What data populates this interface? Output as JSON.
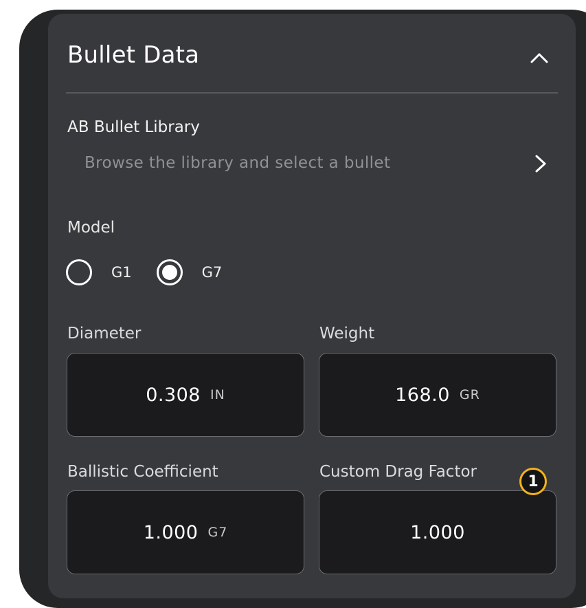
{
  "header": {
    "title": "Bullet Data",
    "collapse_icon": "chevron-up-icon"
  },
  "library": {
    "title": "AB Bullet Library",
    "subtitle": "Browse the library and select a bullet",
    "chevron_icon": "chevron-right-icon"
  },
  "model": {
    "label": "Model",
    "options": [
      {
        "label": "G1",
        "selected": false
      },
      {
        "label": "G7",
        "selected": true
      }
    ]
  },
  "fields": {
    "diameter": {
      "label": "Diameter",
      "value": "0.308",
      "unit": "IN"
    },
    "weight": {
      "label": "Weight",
      "value": "168.0",
      "unit": "GR"
    },
    "ballistic_coefficient": {
      "label": "Ballistic Coefficient",
      "value": "1.000",
      "unit": "G7"
    },
    "custom_drag_factor": {
      "label": "Custom Drag Factor",
      "value": "1.000"
    }
  },
  "badge": {
    "number": "1"
  },
  "colors": {
    "device_bg": "#242628",
    "panel_bg": "#37393c",
    "field_bg": "#1b1a1c",
    "badge_ring": "#f6b21b",
    "muted_text": "#8e9195"
  }
}
